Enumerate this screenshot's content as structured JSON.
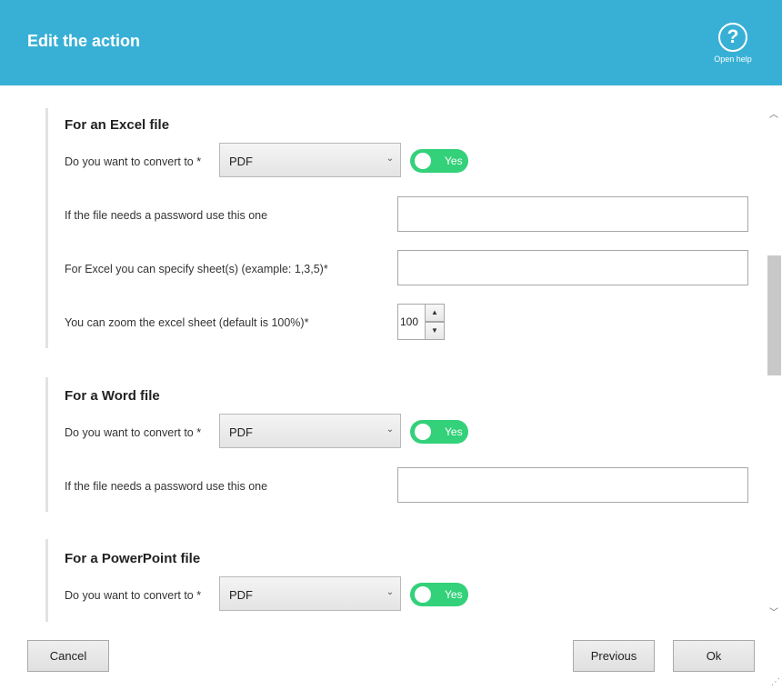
{
  "header": {
    "title": "Edit the action",
    "help_label": "Open help",
    "help_glyph": "?"
  },
  "sections": {
    "excel": {
      "title": "For an Excel file",
      "convert_label": "Do you want to convert to *",
      "convert_value": "PDF",
      "toggle_label": "Yes",
      "password_label": "If the file needs a password use this one",
      "password_value": "",
      "sheets_label": "For Excel you can specify sheet(s) (example: 1,3,5)*",
      "sheets_value": "",
      "zoom_label": "You can zoom the excel sheet (default is 100%)*",
      "zoom_value": "100"
    },
    "word": {
      "title": "For a Word file",
      "convert_label": "Do you want to convert to *",
      "convert_value": "PDF",
      "toggle_label": "Yes",
      "password_label": "If the file needs a password use this one",
      "password_value": ""
    },
    "powerpoint": {
      "title": "For a PowerPoint file",
      "convert_label": "Do you want to convert to *",
      "convert_value": "PDF",
      "toggle_label": "Yes"
    }
  },
  "footer": {
    "cancel_label": "Cancel",
    "previous_label": "Previous",
    "ok_label": "Ok"
  },
  "icons": {
    "chevron_down": "⌄",
    "spin_up": "▲",
    "spin_down": "▼",
    "scroll_up": "︿",
    "scroll_down": "﹀"
  },
  "colors": {
    "header_bg": "#38b0d6",
    "toggle_on": "#33d17a"
  }
}
